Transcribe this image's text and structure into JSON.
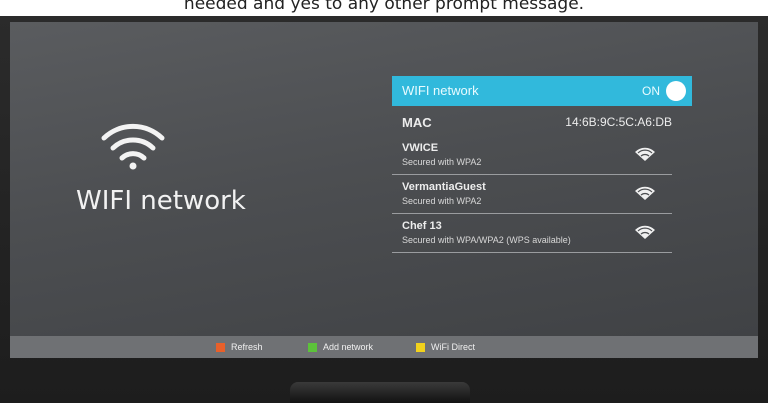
{
  "caption": "needed and yes to any other prompt message.",
  "left": {
    "title": "WIFI network",
    "icon": "wifi-icon"
  },
  "panel": {
    "header": {
      "title": "WIFI network",
      "toggle_state": "ON"
    },
    "mac": {
      "label": "MAC",
      "value": "14:6B:9C:5C:A6:DB"
    },
    "networks": [
      {
        "ssid": "VWICE",
        "security": "Secured with WPA2",
        "icon": "wifi-signal-icon"
      },
      {
        "ssid": "VermantiaGuest",
        "security": "Secured with WPA2",
        "icon": "wifi-signal-icon"
      },
      {
        "ssid": "Chef 13",
        "security": "Secured with WPA/WPA2 (WPS available)",
        "icon": "wifi-signal-icon"
      }
    ]
  },
  "footer": {
    "actions": [
      {
        "label": "Refresh",
        "color": "#e8602a"
      },
      {
        "label": "Add network",
        "color": "#5cc23a"
      },
      {
        "label": "WiFi Direct",
        "color": "#f2d21c"
      }
    ]
  },
  "colors": {
    "accent": "#31b9dc",
    "screen_bg": "#4c4e51"
  }
}
